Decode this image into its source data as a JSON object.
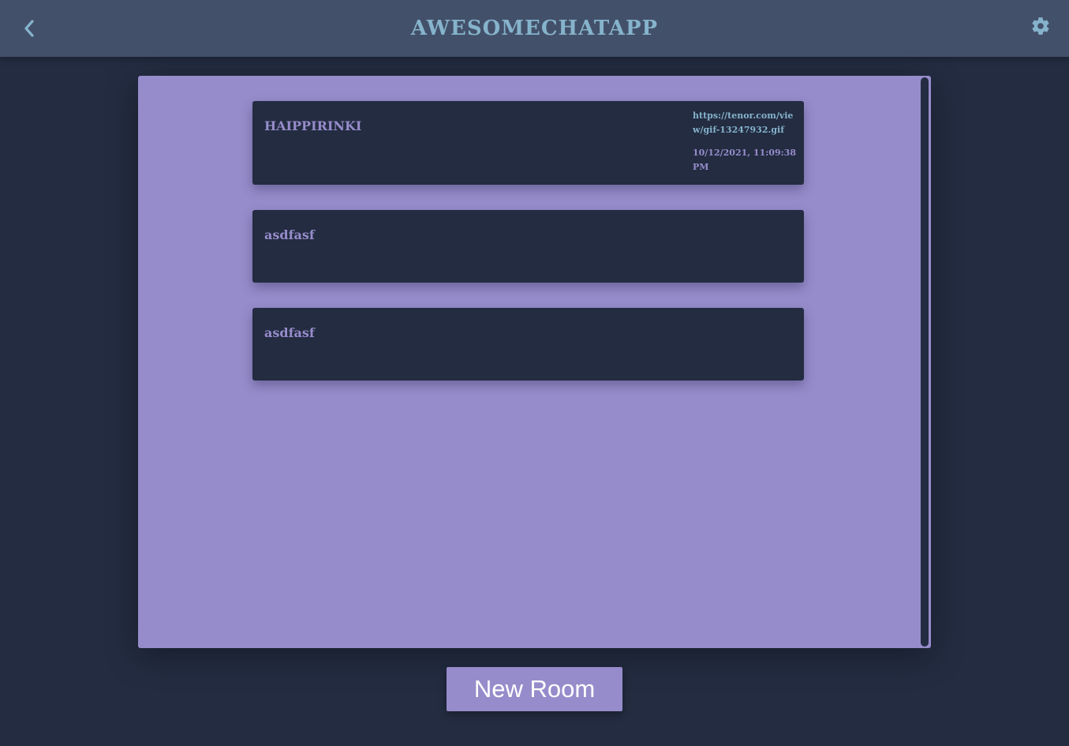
{
  "header": {
    "title": "AWESOMECHATAPP",
    "back_icon": "chevron-left-icon",
    "settings_icon": "gear-icon"
  },
  "rooms": [
    {
      "name": "HAIPPIRINKI",
      "last_message": "https://tenor.com/view/gif-13247932.gif",
      "last_message_visible": "https://tenor.com/vie gif-13247932.gif",
      "timestamp": "10/12/2021, 11:09:38 PM"
    },
    {
      "name": "asdfasf",
      "last_message": "",
      "timestamp": ""
    },
    {
      "name": "asdfasf",
      "last_message": "",
      "timestamp": ""
    }
  ],
  "actions": {
    "new_room_label": "New Room"
  },
  "colors": {
    "background": "#232c41",
    "header": "#435069",
    "accent_purple": "#978ccb",
    "accent_blue": "#86b3cc",
    "button_text": "#ffffff"
  }
}
